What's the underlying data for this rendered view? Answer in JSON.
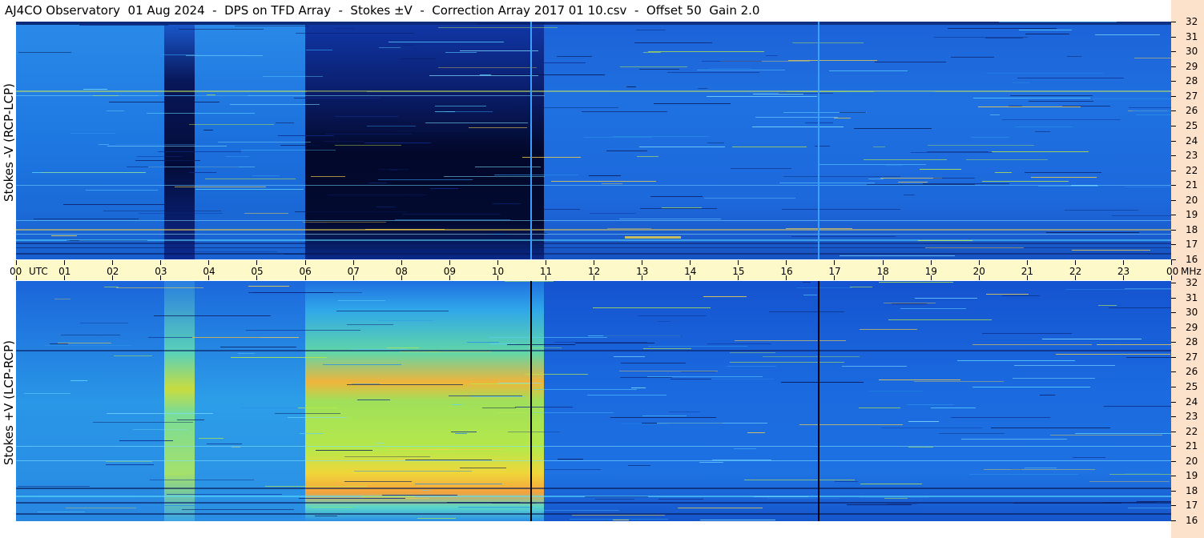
{
  "header": {
    "title": "AJ4CO Observatory  01 Aug 2024  -  DPS on TFD Array  -  Stokes ±V  -  Correction Array 2017 01 10.csv  -  Offset 50  Gain 2.0"
  },
  "chart_data": [
    {
      "type": "heatmap",
      "panel": "top",
      "ylabel": "Stokes -V (RCP-LCP)",
      "yunit": "MHz",
      "ylim": [
        16,
        32
      ],
      "yticks": [
        "16",
        "17",
        "18",
        "19",
        "20",
        "21",
        "22",
        "23",
        "24",
        "25",
        "26",
        "27",
        "28",
        "29",
        "30",
        "31",
        "32"
      ],
      "colormap": "jet",
      "dark_intervals_utc": [
        [
          3.1,
          3.7
        ],
        [
          6.0,
          10.95
        ]
      ],
      "vertical_lines_utc": [
        10.7,
        16.7
      ]
    },
    {
      "type": "heatmap",
      "panel": "bottom",
      "ylabel": "Stokes +V (LCP-RCP)",
      "yunit": "MHz",
      "ylim": [
        16,
        32
      ],
      "yticks": [
        "16",
        "17",
        "18",
        "19",
        "20",
        "21",
        "22",
        "23",
        "24",
        "25",
        "26",
        "27",
        "28",
        "29",
        "30",
        "31",
        "32"
      ],
      "colormap": "jet",
      "bright_intervals_utc": [
        [
          3.1,
          3.7
        ],
        [
          6.0,
          10.95
        ]
      ],
      "vertical_lines_utc": [
        10.7,
        16.7
      ]
    }
  ],
  "time_axis": {
    "labels": [
      "00",
      "01",
      "02",
      "03",
      "04",
      "05",
      "06",
      "07",
      "08",
      "09",
      "10",
      "11",
      "12",
      "13",
      "14",
      "15",
      "16",
      "17",
      "18",
      "19",
      "20",
      "21",
      "22",
      "23",
      "00"
    ],
    "utc_label": "UTC",
    "mhz_label": "MHz"
  },
  "colors": {
    "background_blue": "#1a73e0",
    "dark_band": "#04103a",
    "bright_band": "#9ee04a",
    "axis_strip": "#fef9c8",
    "right_strip": "#fde2cb"
  }
}
